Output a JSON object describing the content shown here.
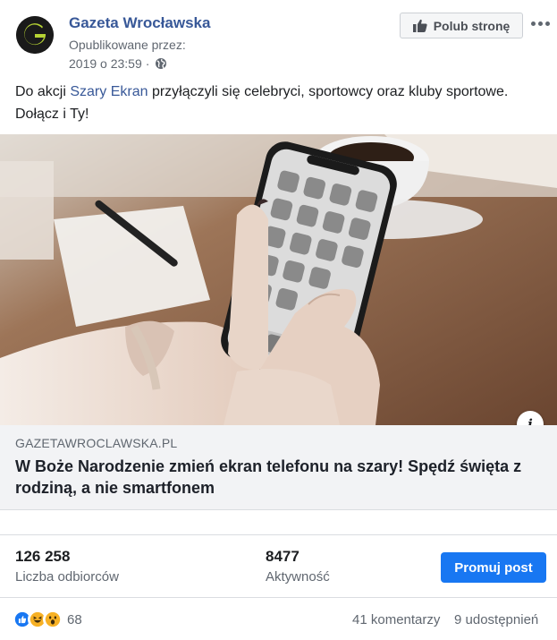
{
  "header": {
    "page_name": "Gazeta Wrocławska",
    "published_by": "Opublikowane przez:",
    "timestamp": "2019 o 23:59",
    "separator": "·",
    "like_page_label": "Polub stronę"
  },
  "post": {
    "text_before": "Do akcji ",
    "text_link": "Szary Ekran",
    "text_after": " przyłączyli się celebryci, sportowcy oraz kluby sportowe. Dołącz i Ty!"
  },
  "link_preview": {
    "info_symbol": "i",
    "domain": "GAZETAWROCLAWSKA.PL",
    "title": "W Boże Narodzenie zmień ekran telefonu na szary! Spędź święta z rodziną, a nie smartfonem"
  },
  "insights": {
    "reach_value": "126 258",
    "reach_label": "Liczba odbiorców",
    "engagement_value": "8477",
    "engagement_label": "Aktywność",
    "promote_label": "Promuj post"
  },
  "footer": {
    "reaction_count": "68",
    "comments": "41 komentarzy",
    "shares": "9 udostępnień"
  },
  "colors": {
    "brand_blue": "#385898",
    "button_blue": "#1877f2",
    "text_secondary": "#606770"
  },
  "icons": {
    "avatar": "gazeta-logo",
    "like_page": "thumbs-up-icon",
    "more": "more-options-icon",
    "privacy": "globe-icon",
    "reactions": [
      "like-reaction-icon",
      "haha-reaction-icon",
      "wow-reaction-icon"
    ]
  }
}
